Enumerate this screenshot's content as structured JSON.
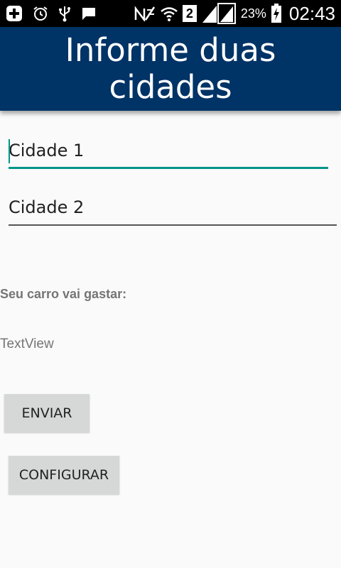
{
  "status_bar": {
    "battery_percent": "23%",
    "sim_slot": "2",
    "time": "02:43",
    "icons": [
      "add-box-icon",
      "alarm-icon",
      "usb-icon",
      "message-icon",
      "no-sim-icon",
      "wifi-icon",
      "signal-icon",
      "battery-charging-icon"
    ]
  },
  "header": {
    "title": "Informe duas cidades",
    "background": "#003366"
  },
  "form": {
    "city1_placeholder": "Cidade 1",
    "city2_placeholder": "Cidade 2",
    "accent": "#009688"
  },
  "result": {
    "label": "Seu carro vai gastar:",
    "value": "TextView"
  },
  "buttons": {
    "send": "ENVIAR",
    "configure": "CONFIGURAR"
  }
}
